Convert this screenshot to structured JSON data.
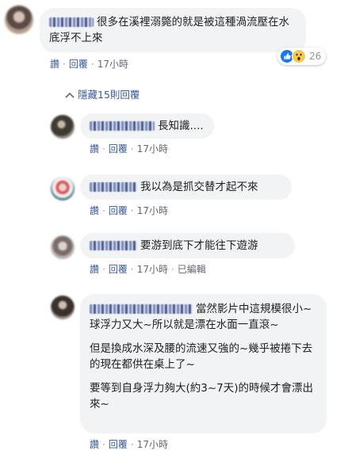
{
  "comments": [
    {
      "text": "很多在溪裡溺斃的就是被這種渦流壓在水底浮不上來",
      "actions": {
        "like": "讚",
        "reply": "回覆",
        "time": "17小時"
      },
      "reaction_count": "26"
    }
  ],
  "hidden_replies_label": "隱藏15則回覆",
  "replies": [
    {
      "text": "長知識....",
      "actions": {
        "like": "讚",
        "reply": "回覆",
        "time": "17小時"
      }
    },
    {
      "text": "我以為是抓交替才起不來",
      "actions": {
        "like": "讚",
        "reply": "回覆",
        "time": "17小時"
      }
    },
    {
      "text": "要游到底下才能往下遊游",
      "actions": {
        "like": "讚",
        "reply": "回覆",
        "time": "17小時",
        "edited": "已編輯"
      }
    },
    {
      "paragraphs": [
        "當然影片中這規模很小~球浮力又大~所以就是漂在水面一直滾~",
        "但是換成水深及腰的流速又強的~幾乎被捲下去的現在都供在桌上了~",
        "要等到自身浮力夠大(約3~7天)的時候才會漂出來~"
      ],
      "actions": {
        "like": "讚",
        "reply": "回覆",
        "time": "17小時"
      }
    }
  ],
  "colors": {
    "link": "#385898",
    "bubble": "#f2f3f5",
    "meta": "#606770",
    "like_blue": "#1877f2",
    "wow_yellow": "#f7c948"
  },
  "icons": [
    "like-reaction-icon",
    "wow-reaction-icon",
    "reply-arrow-icon"
  ]
}
